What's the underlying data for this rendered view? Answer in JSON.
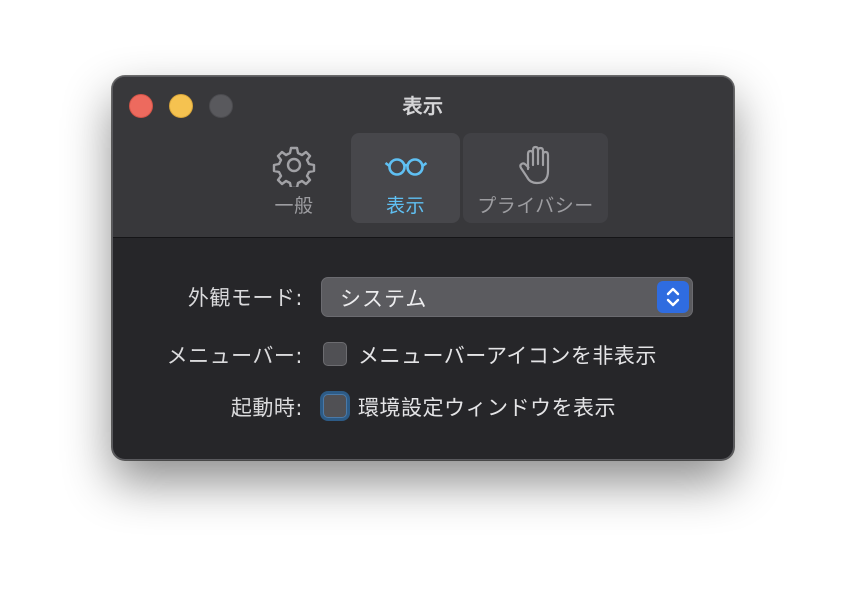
{
  "window": {
    "title": "表示"
  },
  "tabs": [
    {
      "label": "一般",
      "icon": "gear-icon"
    },
    {
      "label": "表示",
      "icon": "glasses-icon",
      "selected": true
    },
    {
      "label": "プライバシー",
      "icon": "hand-icon"
    }
  ],
  "appearance": {
    "label": "外観モード:",
    "value": "システム"
  },
  "menubar": {
    "label": "メニューバー:",
    "checkbox_label": "メニューバーアイコンを非表示",
    "checked": false
  },
  "launch": {
    "label": "起動時:",
    "checkbox_label": "環境設定ウィンドウを表示",
    "checked": false
  },
  "colors": {
    "accent": "#5fc0f3",
    "stepper": "#2f6ce0",
    "close": "#ed6a5e",
    "minimize": "#f5c250"
  }
}
